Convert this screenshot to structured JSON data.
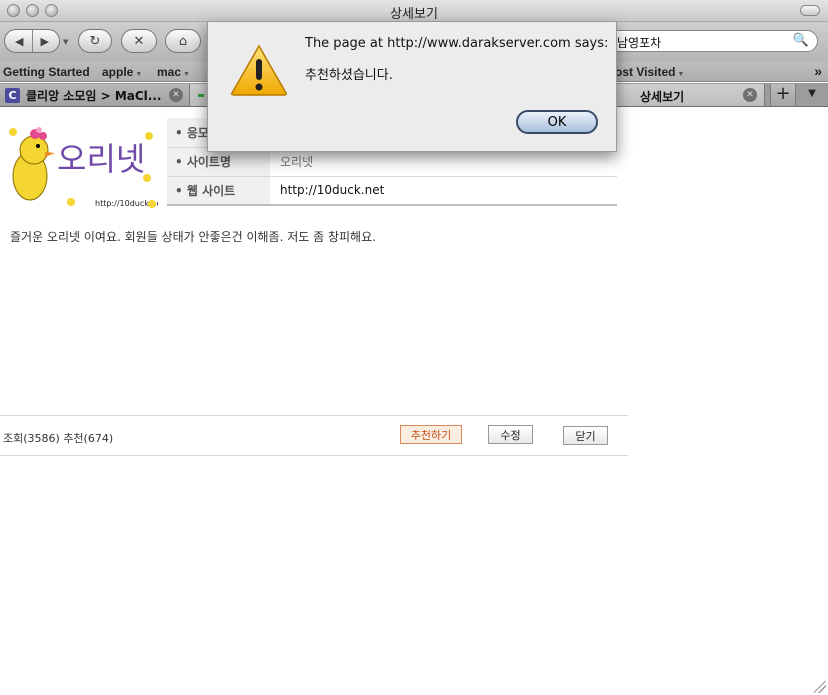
{
  "window": {
    "title": "상세보기"
  },
  "toolbar": {
    "back_icon": "back-arrow-icon",
    "forward_icon": "forward-arrow-icon",
    "reload_icon": "reload-icon",
    "stop_icon": "stop-icon",
    "home_icon": "home-icon",
    "search_value": "남영포차",
    "search_icon": "magnifier-icon"
  },
  "bookmarks": {
    "items": [
      "Getting Started",
      "apple",
      "mac",
      "Most Visited"
    ],
    "more_icon": "double-chevron-icon"
  },
  "tabs": [
    {
      "label": "클리앙 소모임 > MaCl...",
      "favicon": "C"
    },
    {
      "label": "상세보기"
    }
  ],
  "site": {
    "logo_text": "오리넷",
    "logo_url": "http://10duck.net",
    "rows": [
      {
        "label": "• 응모"
      },
      {
        "label": "• 사이트명",
        "value": "오리넷"
      },
      {
        "label": "• 웹 사이트",
        "value": "http://10duck.net"
      }
    ],
    "description": "즐거운 오리넷 이여요. 회원들 상태가 안좋은건 이해좀. 저도 좀 창피해요.",
    "stats": "조회(3586) 추천(674)",
    "buttons": {
      "recommend": "추천하기",
      "edit": "수정",
      "close": "닫기"
    }
  },
  "dialog": {
    "message": "The page at http://www.darakserver.com says:",
    "text": "추천하셨습니다.",
    "ok_label": "OK",
    "icon": "warning-icon"
  },
  "colors": {
    "recommend_text": "#c2501c",
    "recommend_bg": "#fbeee0",
    "dialog_ok": "#a9bfdc"
  }
}
